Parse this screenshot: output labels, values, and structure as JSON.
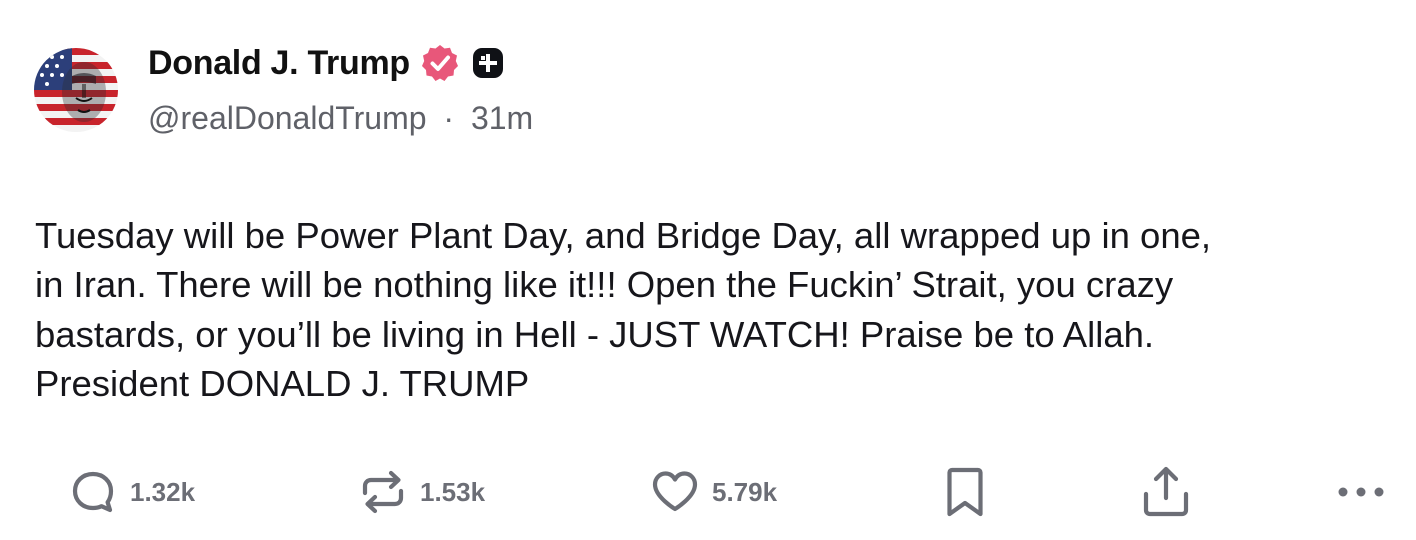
{
  "author": {
    "display_name": "Donald J. Trump",
    "handle": "@realDonaldTrump",
    "separator": "·",
    "time_ago": "31m",
    "verified_badge_color": "#e8577a",
    "plus_badge_color": "#0f1116"
  },
  "post": {
    "text": "Tuesday will be Power Plant Day, and Bridge Day, all wrapped up in one,\nin Iran. There will be nothing like it!!! Open the Fuckin’ Strait, you crazy\nbastards, or you’ll be living in Hell - JUST WATCH! Praise be to Allah.\nPresident DONALD J. TRUMP"
  },
  "actions": {
    "reply": {
      "icon": "reply-icon",
      "count": "1.32k"
    },
    "repost": {
      "icon": "repost-icon",
      "count": "1.53k"
    },
    "like": {
      "icon": "heart-icon",
      "count": "5.79k"
    },
    "bookmark": {
      "icon": "bookmark-icon"
    },
    "share": {
      "icon": "share-icon"
    },
    "more": {
      "icon": "more-icon"
    }
  },
  "colors": {
    "icon_gray": "#6c6e76",
    "text": "#16161b",
    "muted": "#5f6168"
  }
}
